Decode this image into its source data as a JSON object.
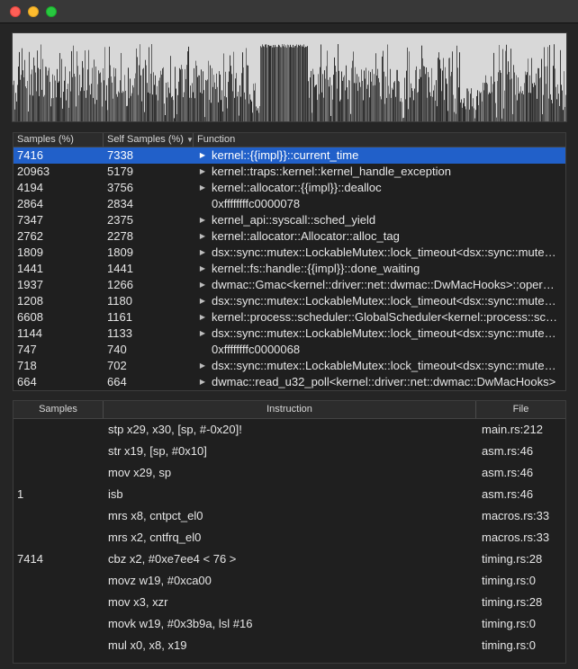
{
  "window": {
    "controls": [
      "close",
      "minimize",
      "maximize"
    ]
  },
  "function_table": {
    "headers": {
      "samples": "Samples (%)",
      "self_samples": "Self Samples (%)",
      "function": "Function"
    },
    "selected_index": 0,
    "rows": [
      {
        "samples": "7416",
        "self": "7338",
        "expandable": true,
        "function": "kernel::{{impl}}::current_time"
      },
      {
        "samples": "20963",
        "self": "5179",
        "expandable": true,
        "function": "kernel::traps::kernel::kernel_handle_exception"
      },
      {
        "samples": "4194",
        "self": "3756",
        "expandable": true,
        "function": "kernel::allocator::{{impl}}::dealloc"
      },
      {
        "samples": "2864",
        "self": "2834",
        "expandable": false,
        "function": "0xffffffffc0000078"
      },
      {
        "samples": "7347",
        "self": "2375",
        "expandable": true,
        "function": "kernel_api::syscall::sched_yield"
      },
      {
        "samples": "2762",
        "self": "2278",
        "expandable": true,
        "function": "kernel::allocator::Allocator::alloc_tag"
      },
      {
        "samples": "1809",
        "self": "1809",
        "expandable": true,
        "function": "dsx::sync::mutex::LockableMutex::lock_timeout<dsx::sync::mutex::M"
      },
      {
        "samples": "1441",
        "self": "1441",
        "expandable": true,
        "function": "kernel::fs::handle::{{impl}}::done_waiting"
      },
      {
        "samples": "1937",
        "self": "1266",
        "expandable": true,
        "function": "dwmac::Gmac<kernel::driver::net::dwmac::DwMacHooks>::operation"
      },
      {
        "samples": "1208",
        "self": "1180",
        "expandable": true,
        "function": "dsx::sync::mutex::LockableMutex::lock_timeout<dsx::sync::mutex::M"
      },
      {
        "samples": "6608",
        "self": "1161",
        "expandable": true,
        "function": "kernel::process::scheduler::GlobalScheduler<kernel::process::sched"
      },
      {
        "samples": "1144",
        "self": "1133",
        "expandable": true,
        "function": "dsx::sync::mutex::LockableMutex::lock_timeout<dsx::sync::mutex::M"
      },
      {
        "samples": "747",
        "self": "740",
        "expandable": false,
        "function": "0xffffffffc0000068"
      },
      {
        "samples": "718",
        "self": "702",
        "expandable": true,
        "function": "dsx::sync::mutex::LockableMutex::lock_timeout<dsx::sync::mutex::M"
      },
      {
        "samples": "664",
        "self": "664",
        "expandable": true,
        "function": "dwmac::read_u32_poll<kernel::driver::net::dwmac::DwMacHooks>"
      }
    ]
  },
  "instruction_table": {
    "headers": {
      "samples": "Samples",
      "instruction": "Instruction",
      "file": "File"
    },
    "rows": [
      {
        "samples": "",
        "instruction": "stp x29, x30, [sp, #-0x20]!",
        "file": "main.rs:212"
      },
      {
        "samples": "",
        "instruction": "str x19, [sp, #0x10]",
        "file": "asm.rs:46"
      },
      {
        "samples": "",
        "instruction": "mov x29, sp",
        "file": "asm.rs:46"
      },
      {
        "samples": "1",
        "instruction": "isb",
        "file": "asm.rs:46"
      },
      {
        "samples": "",
        "instruction": "mrs x8, cntpct_el0",
        "file": "macros.rs:33"
      },
      {
        "samples": "",
        "instruction": "mrs x2, cntfrq_el0",
        "file": "macros.rs:33"
      },
      {
        "samples": "7414",
        "instruction": "cbz x2, #0xe7ee4    < 76 >",
        "file": "timing.rs:28"
      },
      {
        "samples": "",
        "instruction": "movz w19, #0xca00",
        "file": "timing.rs:0"
      },
      {
        "samples": "",
        "instruction": "mov x3, xzr",
        "file": "timing.rs:28"
      },
      {
        "samples": "",
        "instruction": "movk w19, #0x3b9a, lsl #16",
        "file": "timing.rs:0"
      },
      {
        "samples": "",
        "instruction": "mul x0, x8, x19",
        "file": "timing.rs:0"
      }
    ]
  },
  "colors": {
    "selection": "#2160c9",
    "waveform_bg": "#d8d8d8",
    "waveform_fg": "#262626"
  }
}
